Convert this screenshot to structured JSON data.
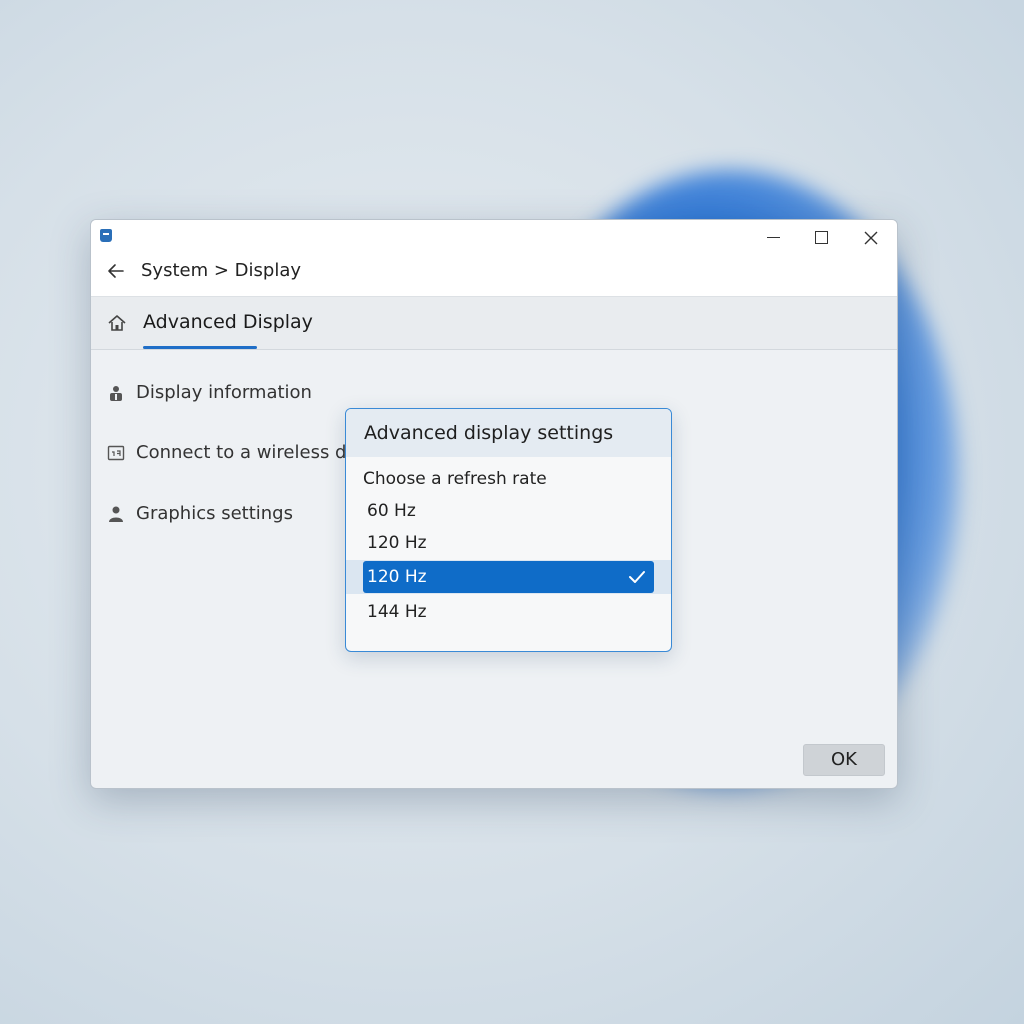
{
  "window": {
    "breadcrumb": "System > Display",
    "page_title": "Advanced Display",
    "controls": {
      "minimize": "minimize",
      "maximize": "maximize",
      "close": "close"
    }
  },
  "sidebar": {
    "items": [
      {
        "label": "Display information",
        "icon": "person-icon"
      },
      {
        "label": "Connect to a wireless dis",
        "icon": "cast-icon"
      },
      {
        "label": "Graphics settings",
        "icon": "person-icon"
      }
    ]
  },
  "dialog": {
    "title": "Advanced display settings",
    "subtitle": "Choose a refresh rate",
    "options": [
      {
        "label": "60 Hz",
        "selected": false
      },
      {
        "label": "120 Hz",
        "selected": false
      },
      {
        "label": "120 Hz",
        "selected": true
      },
      {
        "label": "144 Hz",
        "selected": false
      }
    ]
  },
  "footer": {
    "ok_label": "OK"
  },
  "colors": {
    "accent": "#0f6cc8",
    "underline": "#1f6ec7",
    "background_blob": "#2a74d4"
  }
}
